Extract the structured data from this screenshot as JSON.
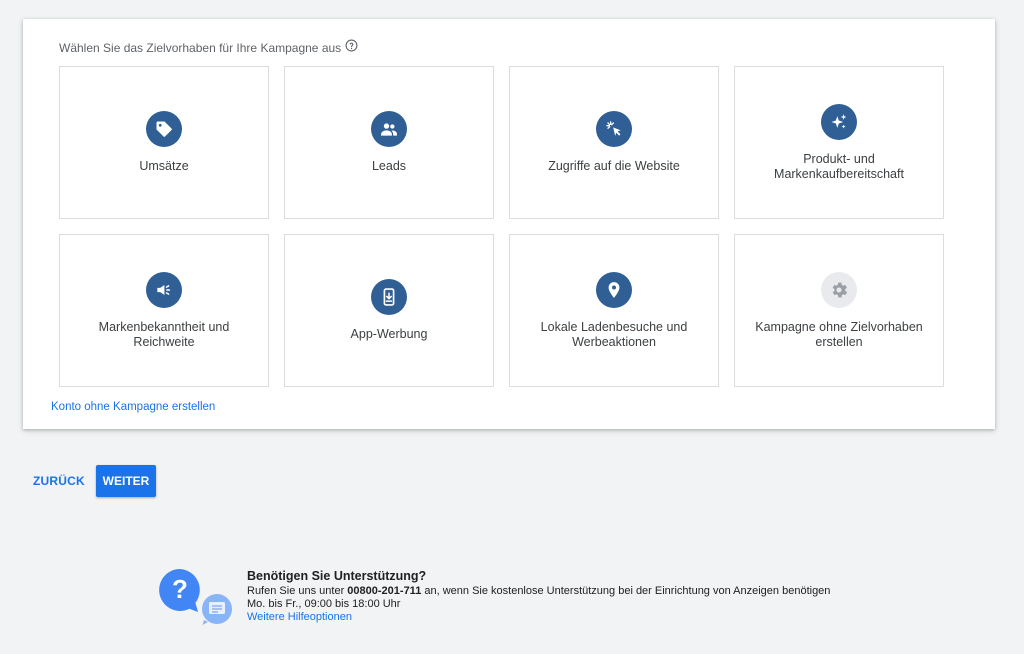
{
  "prompt": "Wählen Sie das Zielvorhaben für Ihre Kampagne aus",
  "tiles": [
    {
      "label": "Umsätze",
      "icon": "tag-icon"
    },
    {
      "label": "Leads",
      "icon": "people-icon"
    },
    {
      "label": "Zugriffe auf die Website",
      "icon": "cursor-click-icon"
    },
    {
      "label": "Produkt- und Markenkaufbereitschaft",
      "icon": "sparkle-icon"
    },
    {
      "label": "Markenbekanntheit und Reichweite",
      "icon": "megaphone-icon"
    },
    {
      "label": "App-Werbung",
      "icon": "phone-download-icon"
    },
    {
      "label": "Lokale Ladenbesuche und Werbeaktionen",
      "icon": "location-pin-icon"
    },
    {
      "label": "Kampagne ohne Zielvorhaben erstellen",
      "icon": "gear-icon"
    }
  ],
  "no_campaign_link": "Konto ohne Kampagne erstellen",
  "buttons": {
    "back": "ZURÜCK",
    "next": "WEITER"
  },
  "support": {
    "title": "Benötigen Sie Unterstützung?",
    "call_prefix": "Rufen Sie uns unter ",
    "phone": "00800-201-711",
    "call_suffix": " an, wenn Sie kostenlose Unterstützung bei der Einrichtung von Anzeigen benötigen",
    "hours": "Mo. bis Fr., 09:00 bis 18:00 Uhr",
    "more_link": "Weitere Hilfeoptionen"
  },
  "colors": {
    "accent": "#1a73e8",
    "icon_bg": "#2f5f95",
    "page_bg": "#f1f3f4"
  }
}
